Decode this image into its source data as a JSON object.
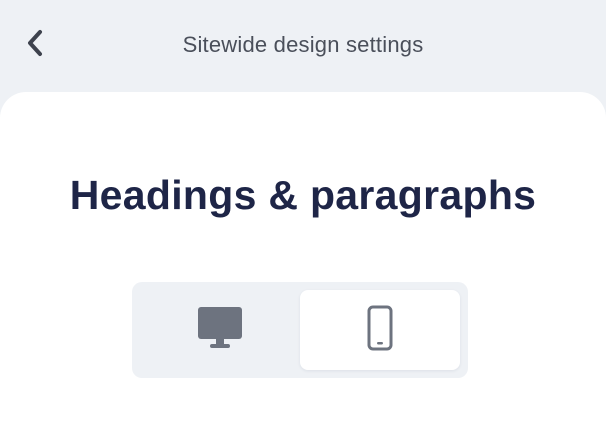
{
  "header": {
    "title": "Sitewide design settings",
    "back_icon": "chevron-left-icon"
  },
  "main": {
    "heading": "Headings & paragraphs",
    "device_toggle": {
      "options": [
        {
          "icon": "desktop-icon",
          "selected": false
        },
        {
          "icon": "mobile-icon",
          "selected": true
        }
      ]
    }
  },
  "colors": {
    "background": "#eef1f5",
    "panel": "#ffffff",
    "heading": "#1e2547",
    "title": "#4a4f5a",
    "icon": "#6d737f"
  }
}
